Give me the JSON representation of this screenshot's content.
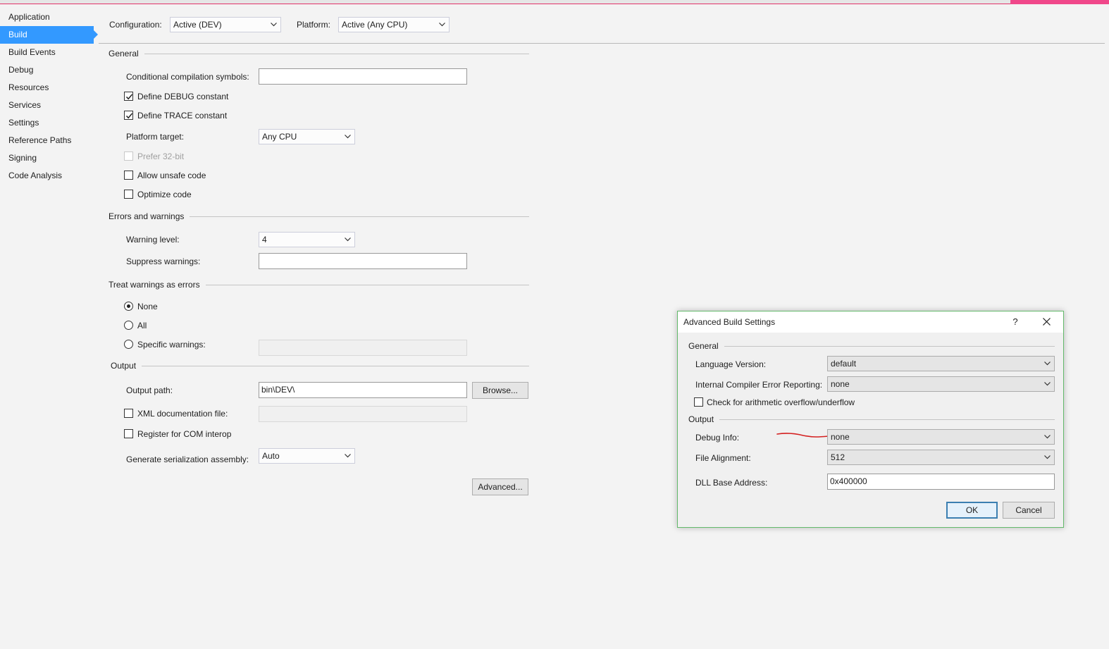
{
  "sidebar": {
    "items": [
      {
        "label": "Application",
        "active": false
      },
      {
        "label": "Build",
        "active": true
      },
      {
        "label": "Build Events",
        "active": false
      },
      {
        "label": "Debug",
        "active": false
      },
      {
        "label": "Resources",
        "active": false
      },
      {
        "label": "Services",
        "active": false
      },
      {
        "label": "Settings",
        "active": false
      },
      {
        "label": "Reference Paths",
        "active": false
      },
      {
        "label": "Signing",
        "active": false
      },
      {
        "label": "Code Analysis",
        "active": false
      }
    ]
  },
  "top": {
    "configuration_label": "Configuration:",
    "configuration_value": "Active (DEV)",
    "platform_label": "Platform:",
    "platform_value": "Active (Any CPU)"
  },
  "general": {
    "title": "General",
    "cond_symbols_label": "Conditional compilation symbols:",
    "cond_symbols_value": "",
    "define_debug_label": "Define DEBUG constant",
    "define_debug_checked": true,
    "define_trace_label": "Define TRACE constant",
    "define_trace_checked": true,
    "platform_target_label": "Platform target:",
    "platform_target_value": "Any CPU",
    "prefer32_label": "Prefer 32-bit",
    "prefer32_checked": false,
    "unsafe_label": "Allow unsafe code",
    "unsafe_checked": false,
    "optimize_label": "Optimize code",
    "optimize_checked": false
  },
  "errors": {
    "title": "Errors and warnings",
    "warning_level_label": "Warning level:",
    "warning_level_value": "4",
    "suppress_label": "Suppress warnings:",
    "suppress_value": ""
  },
  "treat": {
    "title": "Treat warnings as errors",
    "none_label": "None",
    "all_label": "All",
    "specific_label": "Specific warnings:",
    "selected": "none",
    "specific_value": ""
  },
  "output": {
    "title": "Output",
    "path_label": "Output path:",
    "path_value": "bin\\DEV\\",
    "browse_label": "Browse...",
    "xml_doc_label": "XML documentation file:",
    "xml_doc_checked": false,
    "xml_doc_value": "",
    "com_label": "Register for COM interop",
    "com_checked": false,
    "serialization_label": "Generate serialization assembly:",
    "serialization_value": "Auto",
    "advanced_label": "Advanced..."
  },
  "dialog": {
    "title": "Advanced Build Settings",
    "help_label": "?",
    "general_title": "General",
    "language_label": "Language Version:",
    "language_value": "default",
    "ice_label": "Internal Compiler Error Reporting:",
    "ice_value": "none",
    "overflow_label": "Check for arithmetic overflow/underflow",
    "overflow_checked": false,
    "output_title": "Output",
    "debug_info_label": "Debug Info:",
    "debug_info_value": "none",
    "file_align_label": "File Alignment:",
    "file_align_value": "512",
    "dll_base_label": "DLL Base Address:",
    "dll_base_value": "0x400000",
    "ok_label": "OK",
    "cancel_label": "Cancel"
  },
  "colors": {
    "accent": "#3399ff",
    "dialog_border": "#63b96a",
    "annotation": "#d42020"
  },
  "icons": [
    "chevron-down-icon",
    "checkmark-icon",
    "close-icon"
  ]
}
